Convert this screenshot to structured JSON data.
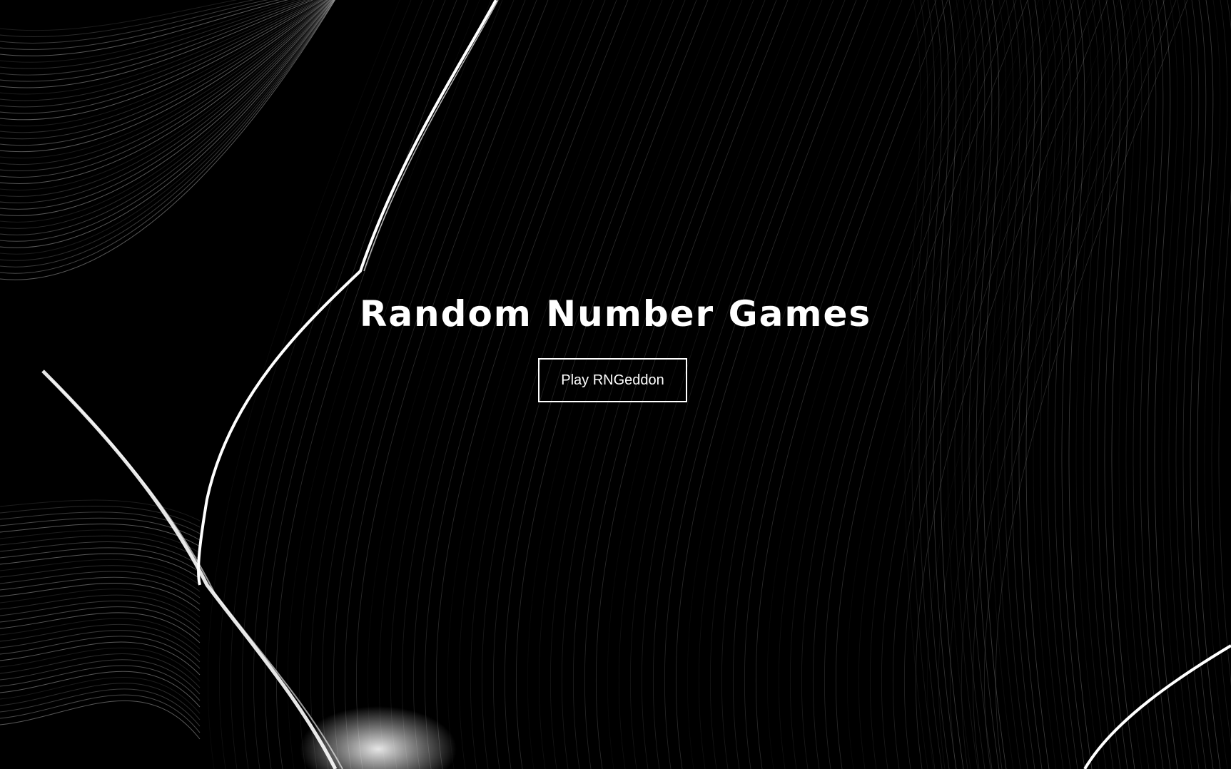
{
  "page": {
    "title": "Random Number Games"
  },
  "actions": {
    "play_label": "Play RNGeddon"
  },
  "theme": {
    "background": "#000000",
    "foreground": "#ffffff"
  }
}
